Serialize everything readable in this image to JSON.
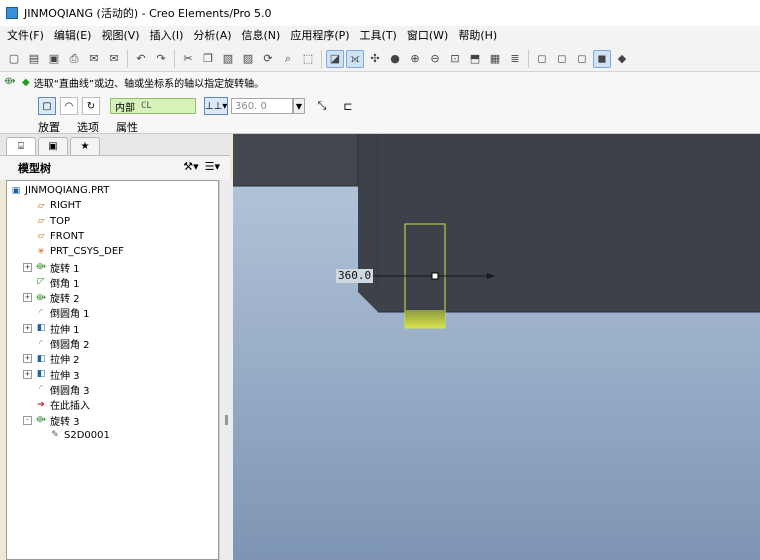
{
  "window": {
    "title": "JINMOQIANG (活动的) - Creo Elements/Pro 5.0"
  },
  "menu": [
    "文件(F)",
    "编辑(E)",
    "视图(V)",
    "插入(I)",
    "分析(A)",
    "信息(N)",
    "应用程序(P)",
    "工具(T)",
    "窗口(W)",
    "帮助(H)"
  ],
  "message": {
    "text": "选取“直曲线”或边、轴或坐标系的轴以指定旋转轴。"
  },
  "dashboard": {
    "axis_value": "内部",
    "axis_ref": "CL",
    "angle_value": "360. 0",
    "slideups": [
      "放置",
      "选项",
      "属性"
    ]
  },
  "navigator": {
    "title": "模型树"
  },
  "tree": [
    {
      "label": "JINMOQIANG.PRT",
      "icon": "part-icon",
      "indent": 0,
      "expander": ""
    },
    {
      "label": "RIGHT",
      "icon": "datum-plane-icon",
      "indent": 1,
      "expander": ""
    },
    {
      "label": "TOP",
      "icon": "datum-plane-icon",
      "indent": 1,
      "expander": ""
    },
    {
      "label": "FRONT",
      "icon": "datum-plane-icon",
      "indent": 1,
      "expander": ""
    },
    {
      "label": "PRT_CSYS_DEF",
      "icon": "csys-icon",
      "indent": 1,
      "expander": ""
    },
    {
      "label": "旋转 1",
      "icon": "revolve-icon",
      "indent": 1,
      "expander": "+"
    },
    {
      "label": "倒角 1",
      "icon": "chamfer-icon",
      "indent": 1,
      "expander": ""
    },
    {
      "label": "旋转 2",
      "icon": "revolve-icon",
      "indent": 1,
      "expander": "+"
    },
    {
      "label": "倒圆角 1",
      "icon": "round-icon",
      "indent": 1,
      "expander": ""
    },
    {
      "label": "拉伸 1",
      "icon": "extrude-icon",
      "indent": 1,
      "expander": "+"
    },
    {
      "label": "倒圆角 2",
      "icon": "round-icon",
      "indent": 1,
      "expander": ""
    },
    {
      "label": "拉伸 2",
      "icon": "extrude-icon",
      "indent": 1,
      "expander": "+"
    },
    {
      "label": "拉伸 3",
      "icon": "extrude-icon",
      "indent": 1,
      "expander": "+"
    },
    {
      "label": "倒圆角 3",
      "icon": "round-icon",
      "indent": 1,
      "expander": ""
    },
    {
      "label": "在此插入",
      "icon": "insert-here-icon",
      "indent": 1,
      "expander": ""
    },
    {
      "label": "旋转 3",
      "icon": "revolve-icon",
      "indent": 1,
      "expander": "-"
    },
    {
      "label": "S2D0001",
      "icon": "sketch-icon",
      "indent": 2,
      "expander": ""
    }
  ],
  "graphics": {
    "dimension_label": "360.0"
  },
  "colors": {
    "sketch_highlight": "#d8e24a",
    "solid_dark": "#3a3f47",
    "background_top": "#b7c9dc",
    "background_bottom": "#7d95b4"
  }
}
